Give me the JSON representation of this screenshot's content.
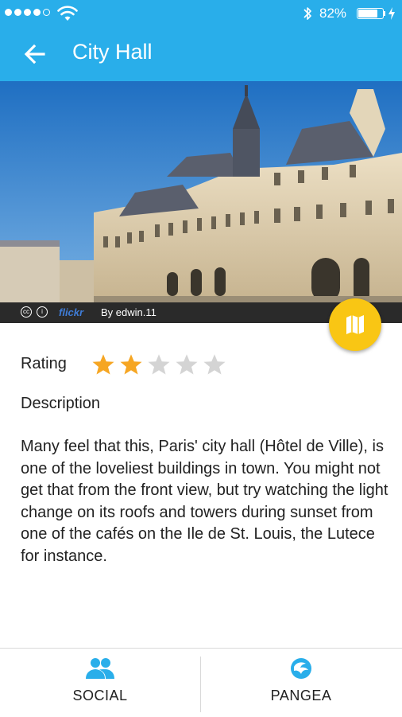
{
  "status_bar": {
    "battery_percent": "82%",
    "battery_level": 0.82,
    "signal_bars_filled": 4,
    "signal_bars_total": 5
  },
  "app_bar": {
    "title": "City Hall",
    "back_icon": "arrow-left-icon",
    "color": "#29aeea"
  },
  "photo": {
    "credit_by": "By edwin.11",
    "credit_source": "flickr",
    "license_icons": [
      "cc-icon",
      "attribution-icon"
    ]
  },
  "map_button": {
    "icon": "map-icon",
    "color": "#f9c614"
  },
  "rating": {
    "label": "Rating",
    "value": 2,
    "max": 5,
    "filled_color": "#f6a623",
    "empty_color": "#d4d4d4"
  },
  "description": {
    "label": "Description",
    "text": "Many feel that this, Paris' city hall (Hôtel de Ville), is one of the loveliest buildings in town. You might not get that from the front view, but try watching the light change on its roofs and towers during sunset from one of the cafés on the Ile de St. Louis, the Lutece for instance."
  },
  "tabs": [
    {
      "label": "SOCIAL",
      "icon": "people-icon"
    },
    {
      "label": "PANGEA",
      "icon": "pangea-logo-icon"
    }
  ]
}
